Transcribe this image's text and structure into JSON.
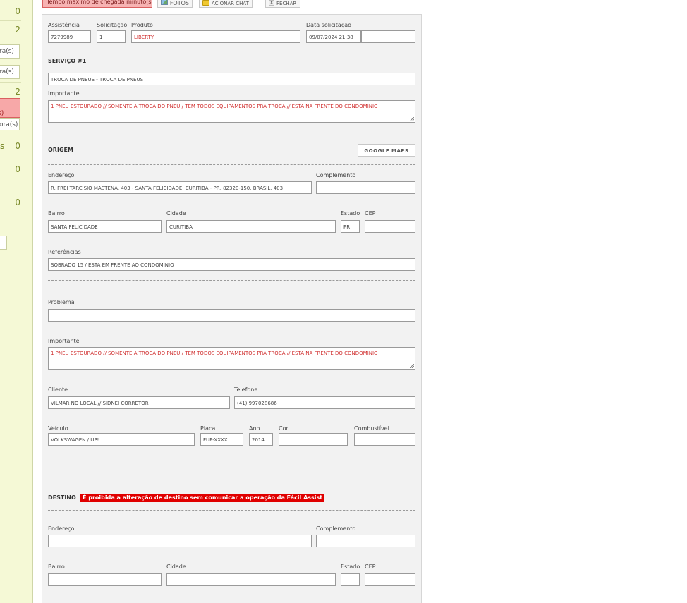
{
  "sidebar": {
    "counts": [
      "0",
      "2",
      "2",
      "0",
      "0",
      "0"
    ],
    "item_s_label": "s",
    "hora_labels": [
      "ra(s)",
      "ra(s)"
    ],
    "red_label": "s)",
    "hora_label_3": "ora(s)"
  },
  "toolbar": {
    "alert_text": "Tempo máximo de chegada minuto(s)",
    "fotos_label": "FOTOS",
    "chat_label": "ACIONAR CHAT",
    "close_label": "FECHAR",
    "close_glyph": "X"
  },
  "header": {
    "assistencia_label": "Assistência",
    "assistencia_value": "7279989",
    "solicitacao_label": "Solicitação",
    "solicitacao_value": "1",
    "produto_label": "Produto",
    "produto_value": "LIBERTY",
    "data_label": "Data solicitação",
    "data_value": "09/07/2024 21:38",
    "extra_value": ""
  },
  "servico": {
    "title": "SERVIÇO #1",
    "value": "TROCA DE PNEUS - TROCA DE PNEUS",
    "importante_label": "Importante",
    "importante_value": "1 PNEU ESTOURADO //  SOMENTE  A TROCA DO PNEU / TEM TODOS EQUIPAMENTOS PRA TROCA //  ESTA  NA FRENTE DO CONDOMINIO"
  },
  "origem": {
    "title": "ORIGEM",
    "maps_button": "GOOGLE MAPS",
    "endereco_label": "Endereço",
    "endereco_value": "R. FREI TARCÍSIO MASTENA, 403 - SANTA FELICIDADE, CURITIBA - PR, 82320-150, BRASIL, 403",
    "complemento_label": "Complemento",
    "complemento_value": "",
    "bairro_label": "Bairro",
    "bairro_value": "SANTA FELICIDADE",
    "cidade_label": "Cidade",
    "cidade_value": "CURITIBA",
    "estado_label": "Estado",
    "estado_value": "PR",
    "cep_label": "CEP",
    "cep_value": "",
    "referencias_label": "Referências",
    "referencias_value": "SOBRADO 15 / ESTA EM FRENTE AO CONDOMÍNIO"
  },
  "detalhes": {
    "problema_label": "Problema",
    "problema_value": "",
    "importante_label": "Importante",
    "importante_value": "1 PNEU ESTOURADO //  SOMENTE  A TROCA DO PNEU / TEM TODOS EQUIPAMENTOS PRA TROCA //  ESTA  NA FRENTE DO CONDOMINIO",
    "cliente_label": "Cliente",
    "cliente_value": "VILMAR NO LOCAL // SIDNEI  CORRETOR",
    "telefone_label": "Telefone",
    "telefone_value": "(41) 997028686",
    "veiculo_label": "Veículo",
    "veiculo_value": "VOLKSWAGEN / UP!",
    "placa_label": "Placa",
    "placa_value": "FUP-XXXX",
    "ano_label": "Ano",
    "ano_value": "2014",
    "cor_label": "Cor",
    "cor_value": "",
    "combustivel_label": "Combustível",
    "combustivel_value": ""
  },
  "destino": {
    "title": "DESTINO",
    "warning": "É proibida a alteração de destino sem comunicar a operação da Fácil Assist",
    "endereco_label": "Endereço",
    "endereco_value": "",
    "complemento_label": "Complemento",
    "complemento_value": "",
    "bairro_label": "Bairro",
    "bairro_value": "",
    "cidade_label": "Cidade",
    "cidade_value": "",
    "estado_label": "Estado",
    "estado_value": "",
    "cep_label": "CEP",
    "cep_value": ""
  }
}
